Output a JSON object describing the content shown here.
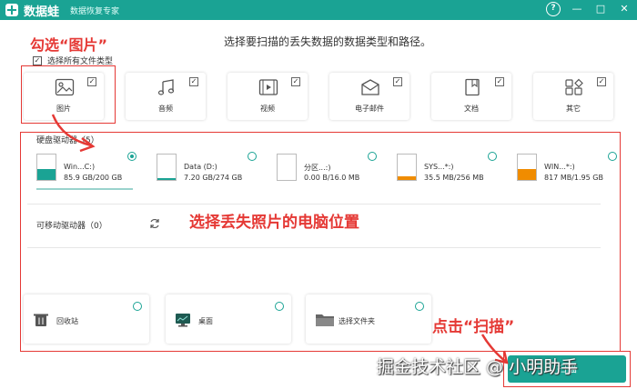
{
  "titlebar": {
    "app_name": "数据蛙",
    "subtitle": "数据恢复专家",
    "help_label": "?",
    "min_label": "—",
    "max_label": "□",
    "close_label": "✕"
  },
  "prompt": "选择要扫描的丢失数据的数据类型和路径。",
  "select_all": {
    "label": "选择所有文件类型",
    "checked": "✓"
  },
  "file_types": [
    {
      "label": "图片",
      "checked": "✓",
      "icon": "image-icon"
    },
    {
      "label": "音频",
      "checked": "✓",
      "icon": "music-icon"
    },
    {
      "label": "视频",
      "checked": "✓",
      "icon": "video-icon"
    },
    {
      "label": "电子邮件",
      "checked": "✓",
      "icon": "mail-icon"
    },
    {
      "label": "文档",
      "checked": "✓",
      "icon": "document-icon"
    },
    {
      "label": "其它",
      "checked": "✓",
      "icon": "other-icon"
    }
  ],
  "hard_drives": {
    "label": "硬盘驱动器（5）",
    "items": [
      {
        "name": "Win...C:)",
        "size": "85.9 GB/200 GB",
        "used": 0.43,
        "color": "#1aa394",
        "selected": true
      },
      {
        "name": "Data (D:)",
        "size": "7.20 GB/274 GB",
        "used": 0.03,
        "color": "#1aa394",
        "selected": false
      },
      {
        "name": "分区...:)",
        "size": "0.00  B/16.0 MB",
        "used": 0.0,
        "color": "#1aa394",
        "selected": false
      },
      {
        "name": "SYS...*:)",
        "size": "35.5 MB/256 MB",
        "used": 0.14,
        "color": "#f08c00",
        "selected": false
      },
      {
        "name": "WIN...*:)",
        "size": "817 MB/1.95 GB",
        "used": 0.42,
        "color": "#f08c00",
        "selected": false
      }
    ]
  },
  "removable": {
    "label": "可移动驱动器（0）"
  },
  "locations": [
    {
      "label": "回收站",
      "icon": "trash-icon"
    },
    {
      "label": "桌面",
      "icon": "desktop-icon"
    },
    {
      "label": "选择文件夹",
      "icon": "folder-icon"
    }
  ],
  "scan_button": "扫描",
  "annotations": {
    "check_images": "勾选“图片”",
    "choose_location": "选择丢失照片的电脑位置",
    "click_scan": "点击“扫描”"
  },
  "watermark": "掘金技术社区 @ 小明助手",
  "colors": {
    "accent": "#1aa394",
    "annotation": "#e53935",
    "warning_fill": "#f08c00"
  }
}
